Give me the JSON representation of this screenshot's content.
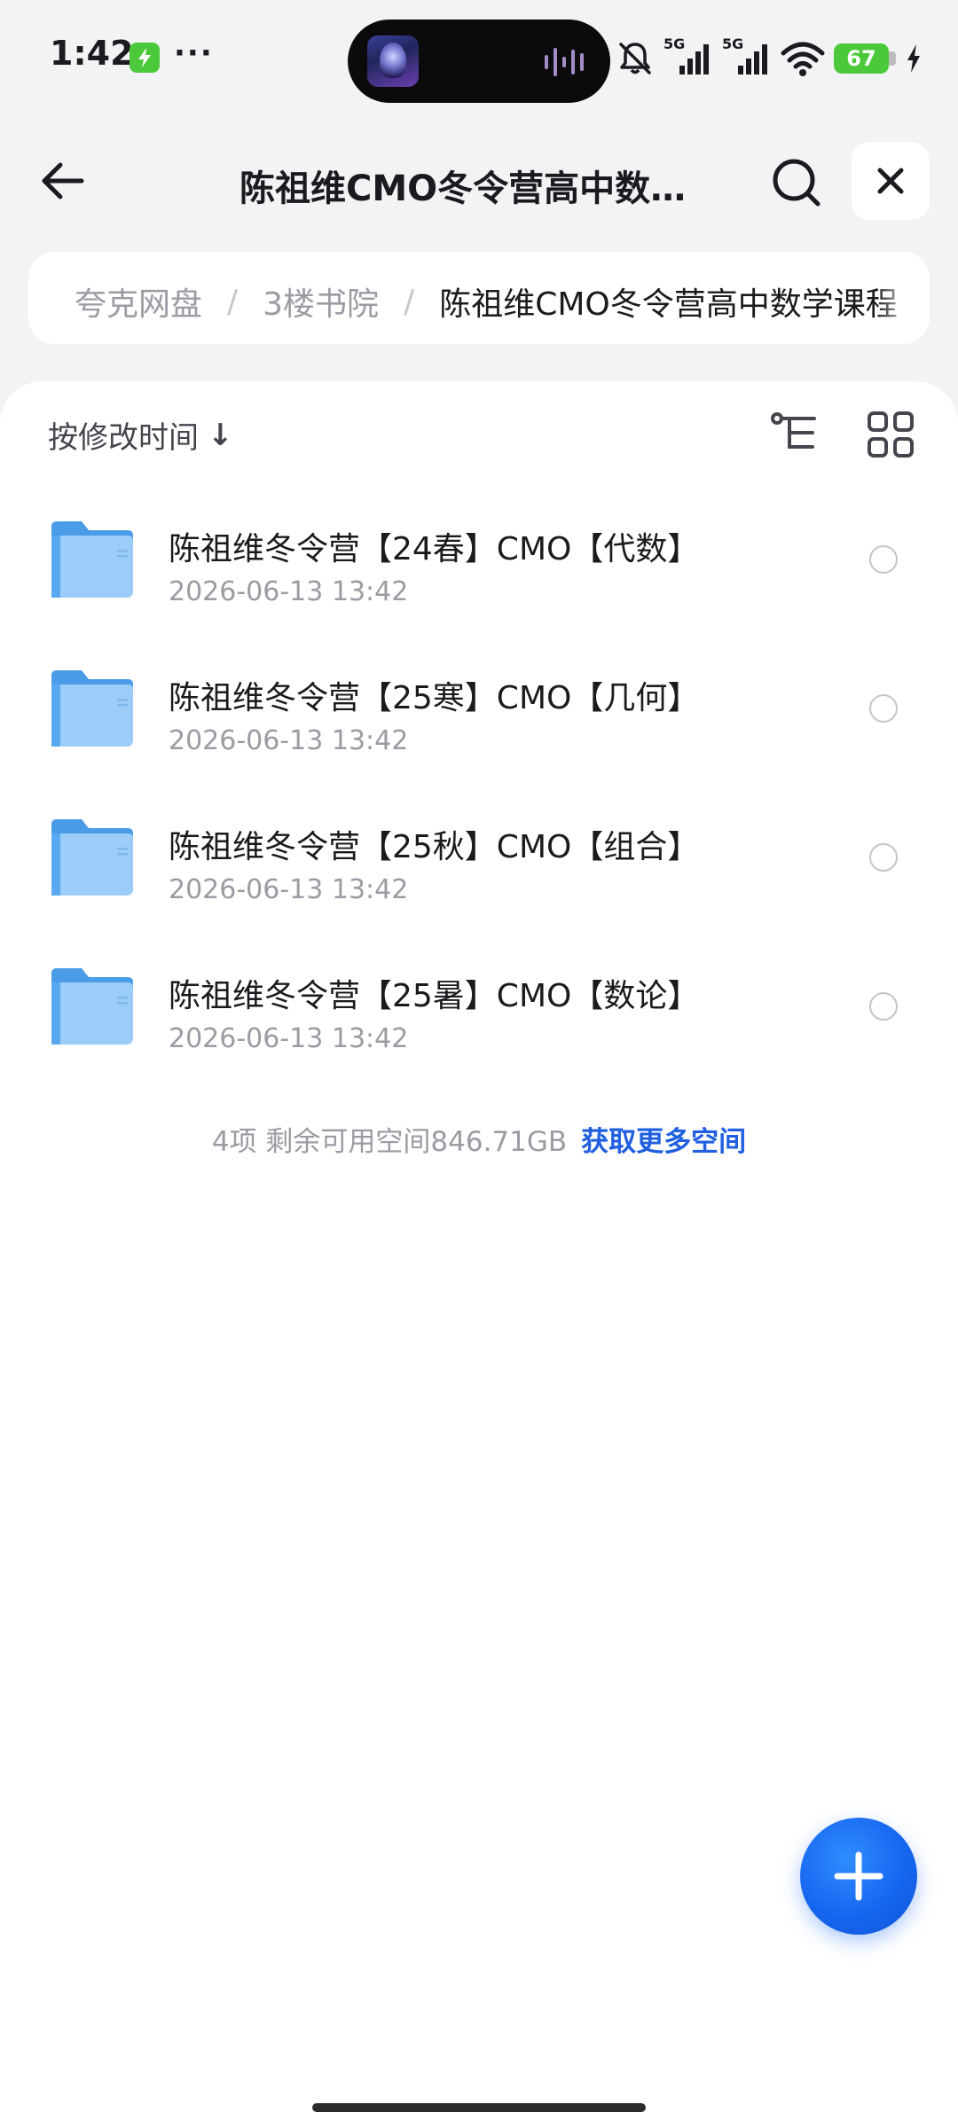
{
  "status_bar": {
    "time": "1:42",
    "more": "···",
    "network_1": "5G",
    "network_2": "5G",
    "battery": "67"
  },
  "header": {
    "title": "陈祖维CMO冬令营高中数学课程",
    "back_icon": "arrow-left-icon",
    "search_icon": "search-icon",
    "close_icon": "close-icon"
  },
  "breadcrumb": {
    "items": [
      "夸克网盘",
      "3楼书院",
      "陈祖维CMO冬令营高中数学课程"
    ],
    "separator": "/"
  },
  "toolbar": {
    "sort_label": "按修改时间",
    "sort_arrow": "↓",
    "tree_icon": "folder-tree-icon",
    "grid_icon": "grid-view-icon"
  },
  "files": [
    {
      "name": "陈祖维冬令营【24春】CMO【代数】",
      "date": "2026-06-13 13:42"
    },
    {
      "name": "陈祖维冬令营【25寒】CMO【几何】",
      "date": "2026-06-13 13:42"
    },
    {
      "name": "陈祖维冬令营【25秋】CMO【组合】",
      "date": "2026-06-13 13:42"
    },
    {
      "name": "陈祖维冬令营【25暑】CMO【数论】",
      "date": "2026-06-13 13:42"
    }
  ],
  "footer": {
    "summary": "4项 剩余可用空间846.71GB",
    "link": "获取更多空间"
  },
  "colors": {
    "accent": "#1f5fe0",
    "folder": "#5aa9f0",
    "charging": "#4cc93b"
  }
}
